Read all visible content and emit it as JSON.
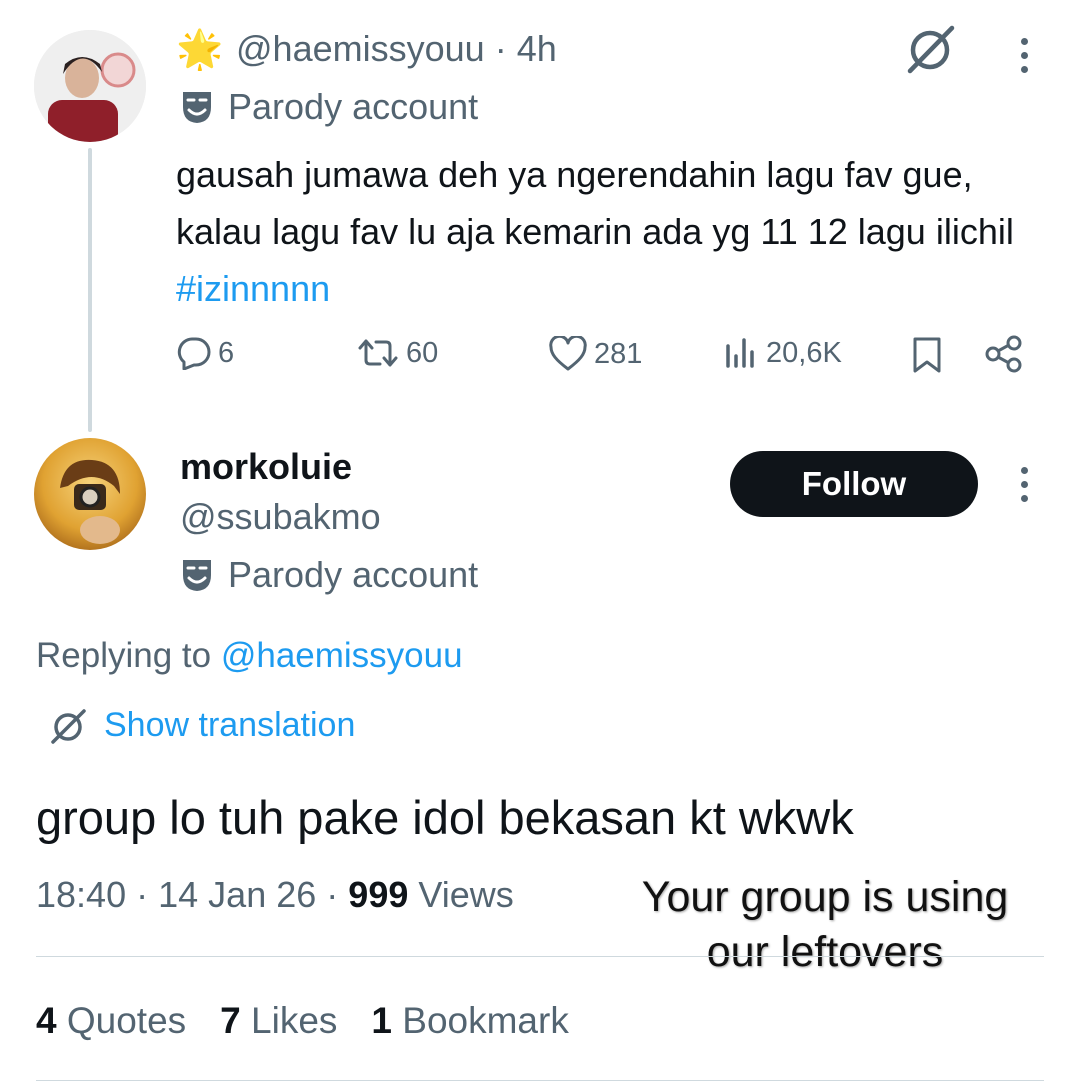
{
  "tweet1": {
    "emoji": "🌟",
    "handle": "@haemissyouu",
    "sep": "·",
    "time": "4h",
    "parody_label": "Parody account",
    "text": "gausah jumawa deh ya ngerendahin lagu fav gue, kalau lagu fav lu aja kemarin ada yg 11 12 lagu ilichil ",
    "hashtag": "#izinnnnn",
    "actions": {
      "replies": "6",
      "reposts": "60",
      "likes": "281",
      "views": "20,6K"
    }
  },
  "tweet2": {
    "name": "morkoluie",
    "handle": "@ssubakmo",
    "parody_label": "Parody account",
    "follow_label": "Follow",
    "replying_prefix": "Replying to ",
    "replying_handle": "@haemissyouu",
    "show_translation": "Show translation",
    "text": "group lo tuh pake idol bekasan kt wkwk",
    "time": "18:40",
    "date": "14 Jan 26",
    "sep": "·",
    "views_count": "999",
    "views_label": "Views",
    "stats": {
      "quotes_count": "4",
      "quotes_label": "Quotes",
      "likes_count": "7",
      "likes_label": "Likes",
      "bookmarks_count": "1",
      "bookmarks_label": "Bookmark"
    }
  },
  "caption": {
    "line1": "Your group is using",
    "line2": "our leftovers"
  },
  "colors": {
    "link": "#1d9bf0",
    "muted": "#536471",
    "text": "#0f1419",
    "follow_bg": "#0f1419"
  }
}
